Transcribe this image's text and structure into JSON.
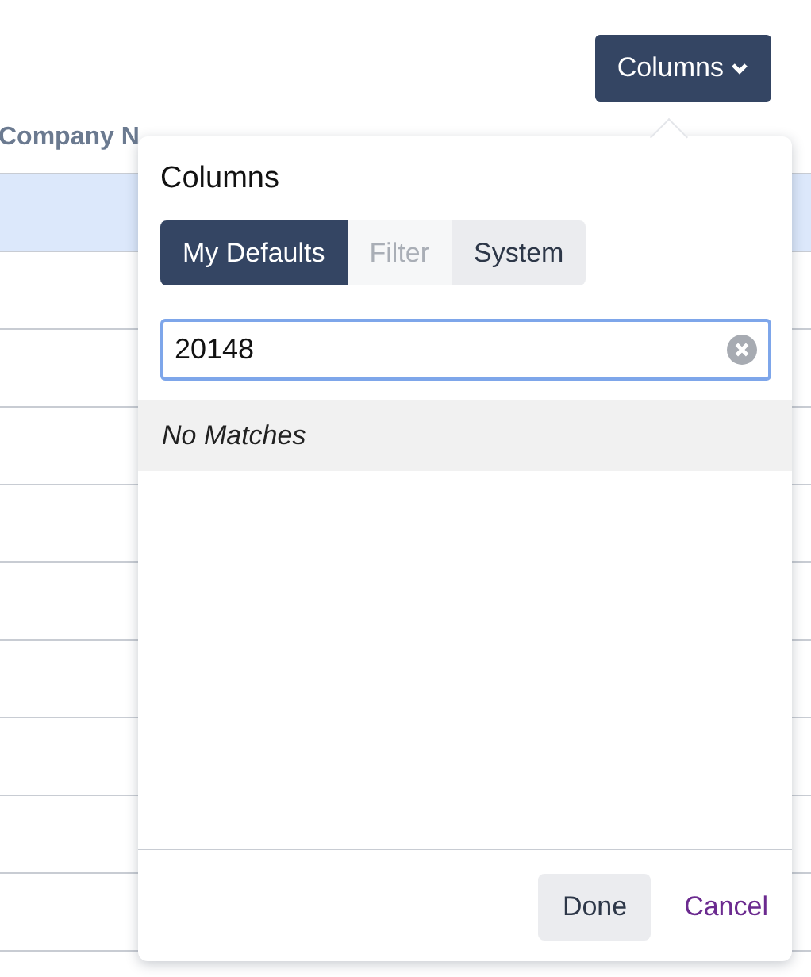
{
  "toolbar": {
    "columns_button": {
      "label": "Columns",
      "expanded": true
    }
  },
  "table": {
    "columns": [
      "Company N"
    ],
    "rows": [
      {
        "selected": true
      },
      {
        "selected": false
      },
      {
        "selected": false
      },
      {
        "selected": false
      },
      {
        "selected": false
      },
      {
        "selected": false
      },
      {
        "selected": false
      },
      {
        "selected": false
      },
      {
        "selected": false
      },
      {
        "selected": false
      }
    ]
  },
  "popover": {
    "title": "Columns",
    "tabs": [
      {
        "label": "My Defaults",
        "selected": true,
        "disabled": false
      },
      {
        "label": "Filter",
        "selected": false,
        "disabled": true
      },
      {
        "label": "System",
        "selected": false,
        "disabled": false
      }
    ],
    "search": {
      "value": "20148"
    },
    "empty_message": "No Matches",
    "buttons": [
      {
        "label": "Done",
        "kind": "primary"
      },
      {
        "label": "Cancel",
        "kind": "link"
      }
    ]
  }
}
